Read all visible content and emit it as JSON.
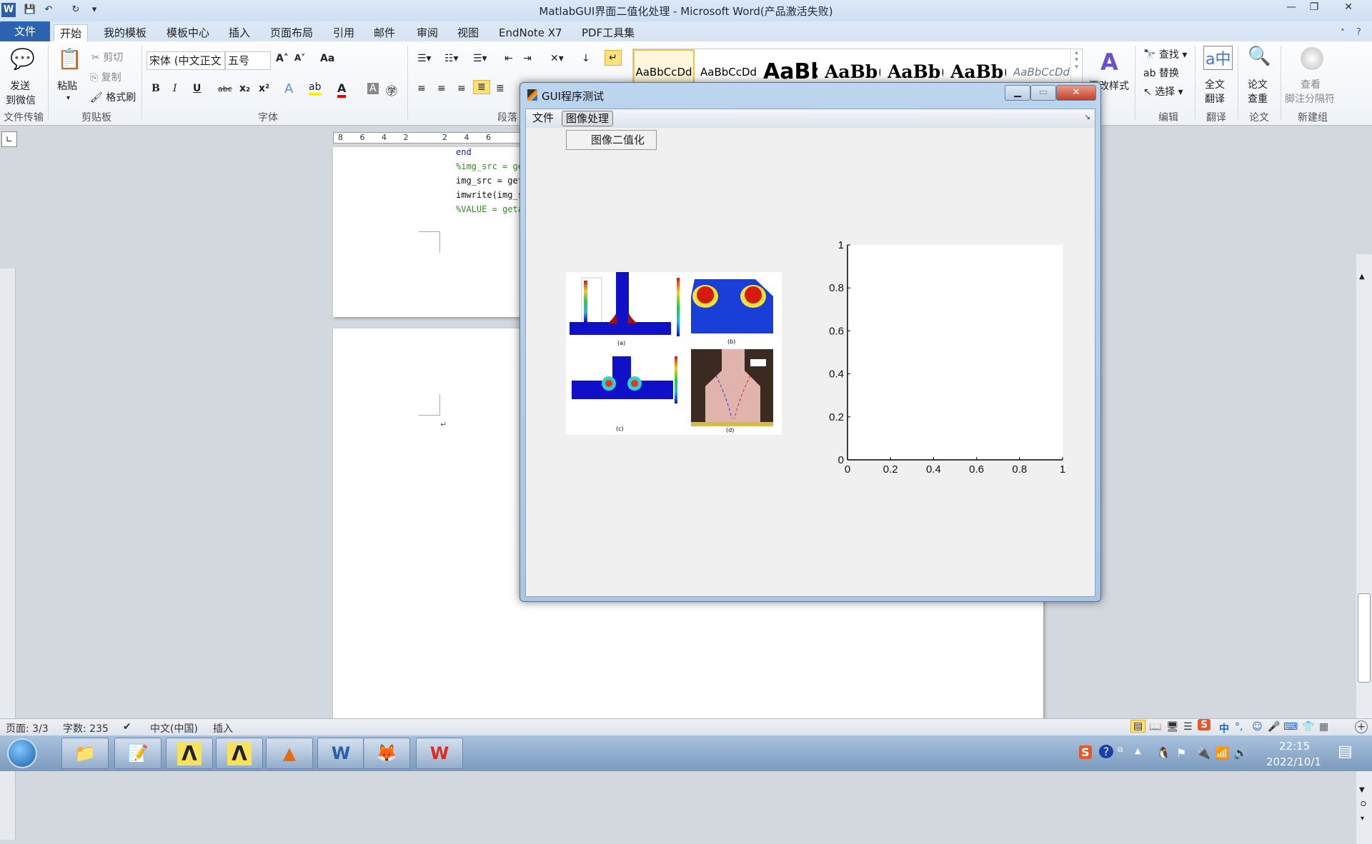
{
  "window": {
    "title": "MatlabGUI界面二值化处理 - Microsoft Word(产品激活失败)",
    "minimize": "—",
    "restore": "❐",
    "close": "✕"
  },
  "quick_access": [
    "W",
    "💾",
    "↶",
    "↻",
    "▾"
  ],
  "tabs": [
    "文件",
    "开始",
    "我的模板",
    "模板中心",
    "插入",
    "页面布局",
    "引用",
    "邮件",
    "审阅",
    "视图",
    "EndNote X7",
    "PDF工具集"
  ],
  "active_tab": "开始",
  "ribbon": {
    "send_wechat": [
      "发送",
      "到微信"
    ],
    "clipboard": {
      "paste": "粘贴",
      "cut": "剪切",
      "copy": "复制",
      "format_painter": "格式刷"
    },
    "font": {
      "name": "宋体 (中文正文",
      "size": "五号",
      "bold": "B",
      "italic": "I",
      "underline": "U",
      "strike": "abc",
      "sub": "x₂",
      "sup": "x²",
      "grow": "A˄",
      "shrink": "A˅",
      "case": "Aa"
    },
    "styles": [
      "AaBbCcDd",
      "AaBbCcDd",
      "AaBb",
      "AaBb(",
      "AaBb(",
      "AaBb(",
      "AaBbCcDd"
    ],
    "change_styles": "更改样式",
    "editing": {
      "find": "查找",
      "replace": "替换",
      "select": "选择"
    },
    "translate": [
      "全文",
      "翻译"
    ],
    "paper_check": [
      "论文",
      "查重"
    ],
    "footnote_sep": [
      "查看",
      "脚注分隔符"
    ],
    "group_labels": {
      "file_transfer": "文件传输",
      "clipboard": "剪贴板",
      "font": "字体",
      "paragraph": "段落",
      "editing": "编辑",
      "translate": "翻译",
      "paper": "论文",
      "new_group": "新建组"
    }
  },
  "ruler": {
    "ticks": [
      "8",
      "6",
      "4",
      "2",
      "",
      "2",
      "4",
      "6"
    ]
  },
  "document": {
    "code_lines": [
      {
        "text": "end",
        "color": "#1a1aa6"
      },
      {
        "text": "%img_src = ge",
        "color": "#3a8a2a"
      },
      {
        "text": "img_src = get",
        "color": "#111111"
      },
      {
        "text": "imwrite(img_s",
        "color": "#111111"
      },
      {
        "text": "%VALUE = getap",
        "color": "#3a8a2a"
      }
    ],
    "paragraph_mark": "↵"
  },
  "gui_window": {
    "title": "GUI程序测试",
    "menus": [
      "文件",
      "图像处理"
    ],
    "open_menu": "图像处理",
    "dropdown_items": [
      "图像二值化"
    ],
    "image_captions": [
      "(a)",
      "(b)",
      "(c)",
      "(d)"
    ]
  },
  "chart_data": {
    "type": "line",
    "title": "",
    "xlabel": "",
    "ylabel": "",
    "x_ticks": [
      "0",
      "0.2",
      "0.4",
      "0.6",
      "0.8",
      "1"
    ],
    "y_ticks": [
      "0",
      "0.2",
      "0.4",
      "0.6",
      "0.8",
      "1"
    ],
    "xlim": [
      0,
      1
    ],
    "ylim": [
      0,
      1
    ],
    "series": [],
    "grid": false
  },
  "status_bar": {
    "page": "页面: 3/3",
    "words": "字数: 235",
    "language": "中文(中国)",
    "mode": "插入"
  },
  "taskbar": {
    "apps": [
      "file-explorer",
      "notepad",
      "app-lambda-1",
      "app-lambda-2",
      "matlab",
      "word",
      "firefox",
      "wps"
    ],
    "time": "22:15",
    "date": "2022/10/1",
    "ime": [
      "中",
      "°,",
      "☺",
      "🎤",
      "⌨"
    ]
  }
}
